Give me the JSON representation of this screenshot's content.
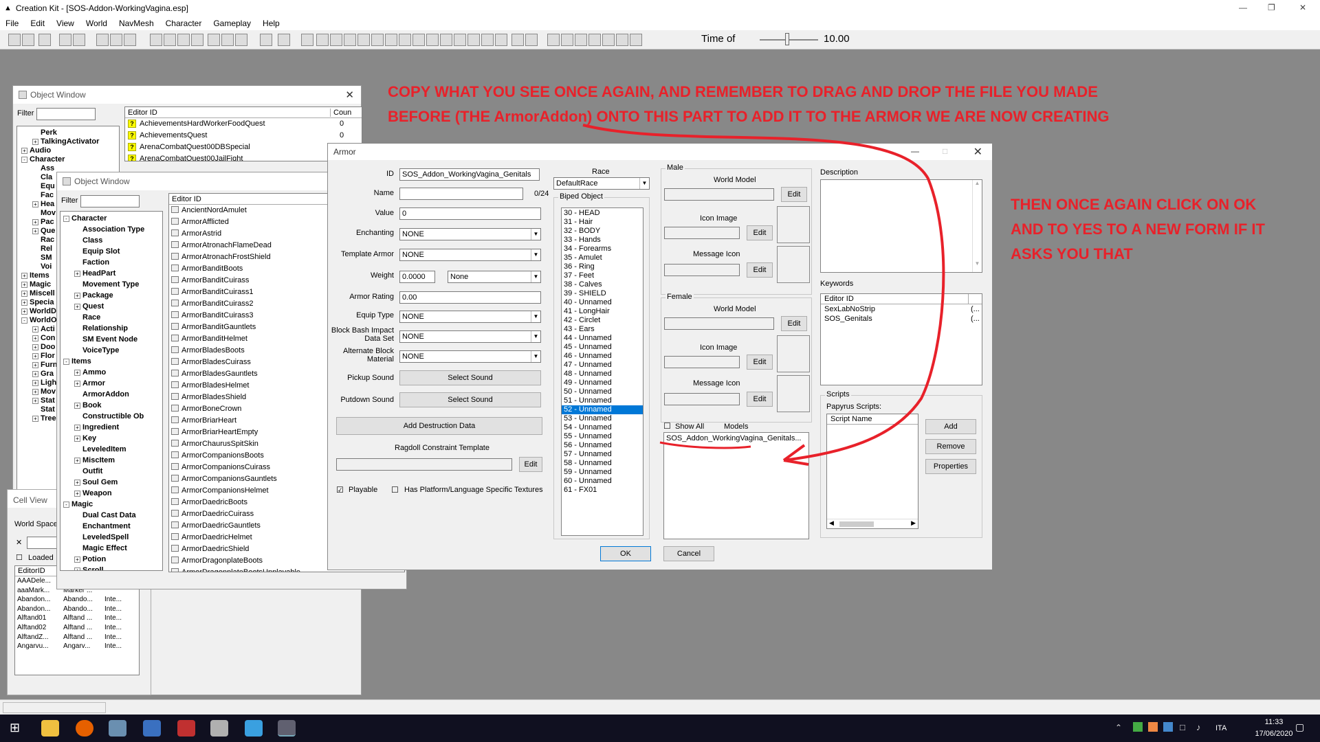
{
  "app": {
    "title": "Creation Kit - [SOS-Addon-WorkingVagina.esp]",
    "menu": [
      "File",
      "Edit",
      "View",
      "World",
      "NavMesh",
      "Character",
      "Gameplay",
      "Help"
    ],
    "time_label": "Time of",
    "time_value": "10.00"
  },
  "object_window_back": {
    "title": "Object Window",
    "filter_label": "Filter",
    "col_editor_id": "Editor ID",
    "col_count": "Coun",
    "tree": [
      {
        "label": "Perk",
        "sign": ""
      },
      {
        "label": "TalkingActivator",
        "sign": "+"
      },
      {
        "label": "Audio",
        "sign": "+"
      },
      {
        "label": "Character",
        "sign": "-"
      },
      {
        "label": "Ass",
        "sign": ""
      },
      {
        "label": "Cla",
        "sign": ""
      },
      {
        "label": "Equ",
        "sign": ""
      },
      {
        "label": "Fac",
        "sign": ""
      },
      {
        "label": "Hea",
        "sign": "+"
      },
      {
        "label": "Mov",
        "sign": ""
      },
      {
        "label": "Pac",
        "sign": "+"
      },
      {
        "label": "Que",
        "sign": "+"
      },
      {
        "label": "Rac",
        "sign": ""
      },
      {
        "label": "Rel",
        "sign": ""
      },
      {
        "label": "SM",
        "sign": ""
      },
      {
        "label": "Voi",
        "sign": ""
      },
      {
        "label": "Items",
        "sign": "+"
      },
      {
        "label": "Magic",
        "sign": "+"
      },
      {
        "label": "Miscell",
        "sign": "+"
      },
      {
        "label": "Specia",
        "sign": "+"
      },
      {
        "label": "WorldD",
        "sign": "+"
      },
      {
        "label": "WorldO",
        "sign": "-"
      },
      {
        "label": "Acti",
        "sign": "+"
      },
      {
        "label": "Con",
        "sign": "+"
      },
      {
        "label": "Doo",
        "sign": "+"
      },
      {
        "label": "Flor",
        "sign": "+"
      },
      {
        "label": "Furn",
        "sign": "+"
      },
      {
        "label": "Gra",
        "sign": "+"
      },
      {
        "label": "Ligh",
        "sign": "+"
      },
      {
        "label": "Mov",
        "sign": "+"
      },
      {
        "label": "Stat",
        "sign": "+"
      },
      {
        "label": "Stat",
        "sign": ""
      },
      {
        "label": "Tree",
        "sign": "+"
      }
    ],
    "rows": [
      {
        "id": "AchievementsHardWorkerFoodQuest",
        "count": "0"
      },
      {
        "id": "AchievementsQuest",
        "count": "0"
      },
      {
        "id": "ArenaCombatQuest00DBSpecial",
        "count": "0"
      },
      {
        "id": "ArenaCombatQuest00JailFight",
        "count": "0"
      }
    ]
  },
  "cell_view": {
    "title": "Cell View",
    "world_space_label": "World Space",
    "loaded_label": "Loaded",
    "col_editor_id": "EditorID",
    "rows": [
      [
        "AAADele...",
        "",
        ""
      ],
      [
        "aaaMark...",
        "Marker ...",
        ""
      ],
      [
        "Abandon...",
        "Abando...",
        "Inte..."
      ],
      [
        "Abandon...",
        "Abando...",
        "Inte..."
      ],
      [
        "Alftand01",
        "Alftand ...",
        "Inte..."
      ],
      [
        "Alftand02",
        "Alftand ...",
        "Inte..."
      ],
      [
        "AlftandZ...",
        "Alftand ...",
        "Inte..."
      ],
      [
        "Angarvu...",
        "Angarv...",
        "Inte..."
      ]
    ]
  },
  "object_window_front": {
    "title": "Object Window",
    "filter_label": "Filter",
    "col_editor_id": "Editor ID",
    "tree": [
      {
        "label": "Character",
        "sign": "-",
        "indent": 0
      },
      {
        "label": "Association Type",
        "sign": "",
        "indent": 1
      },
      {
        "label": "Class",
        "sign": "",
        "indent": 1
      },
      {
        "label": "Equip Slot",
        "sign": "",
        "indent": 1
      },
      {
        "label": "Faction",
        "sign": "",
        "indent": 1
      },
      {
        "label": "HeadPart",
        "sign": "+",
        "indent": 1
      },
      {
        "label": "Movement Type",
        "sign": "",
        "indent": 1
      },
      {
        "label": "Package",
        "sign": "+",
        "indent": 1
      },
      {
        "label": "Quest",
        "sign": "+",
        "indent": 1
      },
      {
        "label": "Race",
        "sign": "",
        "indent": 1
      },
      {
        "label": "Relationship",
        "sign": "",
        "indent": 1
      },
      {
        "label": "SM Event Node",
        "sign": "",
        "indent": 1
      },
      {
        "label": "VoiceType",
        "sign": "",
        "indent": 1
      },
      {
        "label": "Items",
        "sign": "-",
        "indent": 0
      },
      {
        "label": "Ammo",
        "sign": "+",
        "indent": 1
      },
      {
        "label": "Armor",
        "sign": "+",
        "indent": 1
      },
      {
        "label": "ArmorAddon",
        "sign": "",
        "indent": 1
      },
      {
        "label": "Book",
        "sign": "+",
        "indent": 1
      },
      {
        "label": "Constructible Ob",
        "sign": "",
        "indent": 1
      },
      {
        "label": "Ingredient",
        "sign": "+",
        "indent": 1
      },
      {
        "label": "Key",
        "sign": "+",
        "indent": 1
      },
      {
        "label": "LeveledItem",
        "sign": "",
        "indent": 1
      },
      {
        "label": "MiscItem",
        "sign": "+",
        "indent": 1
      },
      {
        "label": "Outfit",
        "sign": "",
        "indent": 1
      },
      {
        "label": "Soul Gem",
        "sign": "+",
        "indent": 1
      },
      {
        "label": "Weapon",
        "sign": "+",
        "indent": 1
      },
      {
        "label": "Magic",
        "sign": "-",
        "indent": 0
      },
      {
        "label": "Dual Cast Data",
        "sign": "",
        "indent": 1
      },
      {
        "label": "Enchantment",
        "sign": "",
        "indent": 1
      },
      {
        "label": "LeveledSpell",
        "sign": "",
        "indent": 1
      },
      {
        "label": "Magic Effect",
        "sign": "",
        "indent": 1
      },
      {
        "label": "Potion",
        "sign": "+",
        "indent": 1
      },
      {
        "label": "Scroll",
        "sign": "+",
        "indent": 1
      }
    ],
    "rows": [
      "AncientNordAmulet",
      "ArmorAfflicted",
      "ArmorAstrid",
      "ArmorAtronachFlameDead",
      "ArmorAtronachFrostShield",
      "ArmorBanditBoots",
      "ArmorBanditCuirass",
      "ArmorBanditCuirass1",
      "ArmorBanditCuirass2",
      "ArmorBanditCuirass3",
      "ArmorBanditGauntlets",
      "ArmorBanditHelmet",
      "ArmorBladesBoots",
      "ArmorBladesCuirass",
      "ArmorBladesGauntlets",
      "ArmorBladesHelmet",
      "ArmorBladesShield",
      "ArmorBoneCrown",
      "ArmorBriarHeart",
      "ArmorBriarHeartEmpty",
      "ArmorChaurusSpitSkin",
      "ArmorCompanionsBoots",
      "ArmorCompanionsCuirass",
      "ArmorCompanionsGauntlets",
      "ArmorCompanionsHelmet",
      "ArmorDaedricBoots",
      "ArmorDaedricCuirass",
      "ArmorDaedricGauntlets",
      "ArmorDaedricHelmet",
      "ArmorDaedricShield",
      "ArmorDragonplateBoots",
      "ArmorDragonplateBootsUnplayable"
    ]
  },
  "armor": {
    "title": "Armor",
    "id_label": "ID",
    "id_value": "SOS_Addon_WorkingVagina_Genitals",
    "name_label": "Name",
    "name_value": "",
    "name_counter": "0/24",
    "value_label": "Value",
    "value_value": "0",
    "enchanting_label": "Enchanting",
    "enchanting_value": "NONE",
    "template_label": "Template Armor",
    "template_value": "NONE",
    "weight_label": "Weight",
    "weight_value": "0.0000",
    "weight_type": "None",
    "rating_label": "Armor Rating",
    "rating_value": "0.00",
    "equip_label": "Equip Type",
    "equip_value": "NONE",
    "bash_label": "Block Bash Impact Data Set",
    "bash_value": "NONE",
    "altblock_label": "Alternate Block Material",
    "altblock_value": "NONE",
    "pickup_label": "Pickup Sound",
    "putdown_label": "Putdown Sound",
    "select_sound": "Select Sound",
    "add_destruction": "Add Destruction Data",
    "ragdoll_label": "Ragdoll Constraint Template",
    "edit": "Edit",
    "playable_label": "Playable",
    "platform_label": "Has Platform/Language Specific Textures",
    "race_label": "Race",
    "race_value": "DefaultRace",
    "biped_label": "Biped Object",
    "biped": [
      "30 - HEAD",
      "31 - Hair",
      "32 - BODY",
      "33 - Hands",
      "34 - Forearms",
      "35 - Amulet",
      "36 - Ring",
      "37 - Feet",
      "38 - Calves",
      "39 - SHIELD",
      "40 - Unnamed",
      "41 - LongHair",
      "42 - Circlet",
      "43 - Ears",
      "44 - Unnamed",
      "45 - Unnamed",
      "46 - Unnamed",
      "47 - Unnamed",
      "48 - Unnamed",
      "49 - Unnamed",
      "50 - Unnamed",
      "51 - Unnamed",
      "52 - Unnamed",
      "53 - Unnamed",
      "54 - Unnamed",
      "55 - Unnamed",
      "56 - Unnamed",
      "57 - Unnamed",
      "58 - Unnamed",
      "59 - Unnamed",
      "60 - Unnamed",
      "61 - FX01"
    ],
    "biped_selected": "52 - Unnamed",
    "male_label": "Male",
    "female_label": "Female",
    "world_model": "World Model",
    "icon_image": "Icon Image",
    "message_icon": "Message Icon",
    "show_all": "Show All",
    "models_label": "Models",
    "model_entry": "SOS_Addon_WorkingVagina_Genitals...",
    "description_label": "Description",
    "keywords_label": "Keywords",
    "keywords_col": "Editor ID",
    "keywords": [
      {
        "name": "SexLabNoStrip",
        "extra": "(..."
      },
      {
        "name": "SOS_Genitals",
        "extra": "(..."
      }
    ],
    "scripts_label": "Scripts",
    "papyrus_label": "Papyrus Scripts:",
    "script_name_col": "Script Name",
    "add": "Add",
    "remove": "Remove",
    "properties": "Properties",
    "ok": "OK",
    "cancel": "Cancel"
  },
  "annotations": {
    "top": "COPY WHAT YOU SEE ONCE AGAIN, AND REMEMBER TO DRAG AND DROP THE FILE YOU MADE BEFORE (THE ArmorAddon) ONTO THIS PART TO ADD IT TO THE ARMOR WE ARE NOW CREATING",
    "right": "THEN ONCE AGAIN CLICK ON OK AND TO YES TO A NEW FORM IF IT ASKS YOU THAT",
    "color": "#e8212a"
  },
  "taskbar": {
    "time": "11:33",
    "date": "17/06/2020",
    "lang": "ITA"
  }
}
